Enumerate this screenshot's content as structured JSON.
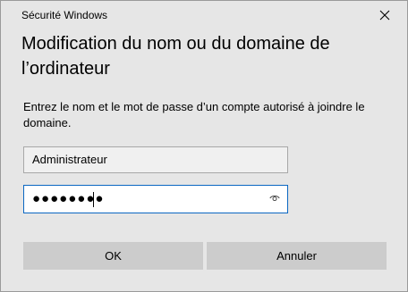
{
  "window": {
    "title": "Sécurité Windows",
    "close_icon": "close-icon"
  },
  "heading": "Modification du nom ou du domaine de l’ordinateur",
  "description": "Entrez le nom et le mot de passe d’un compte autorisé à joindre le domaine.",
  "username_field": {
    "value": "Administrateur"
  },
  "password_field": {
    "masked_value": "●●●●●●●●",
    "reveal_icon": "eye-icon"
  },
  "buttons": {
    "ok_label": "OK",
    "cancel_label": "Annuler"
  },
  "colors": {
    "background": "#e6e6e6",
    "button": "#cccccc",
    "focus_border": "#0a67c2"
  }
}
